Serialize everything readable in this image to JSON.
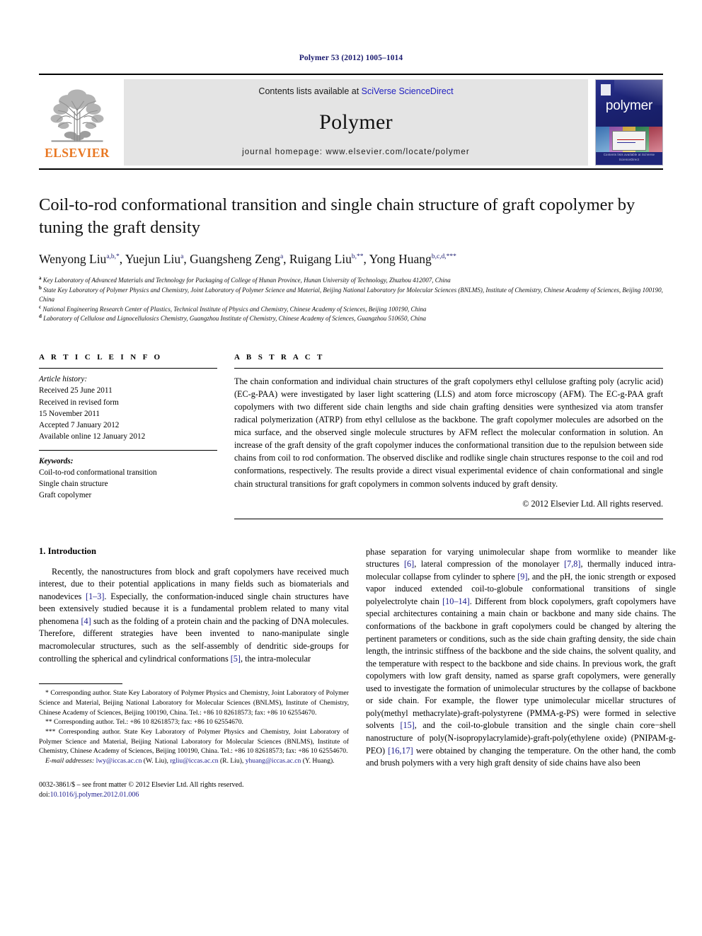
{
  "running_head": "Polymer 53 (2012) 1005–1014",
  "header": {
    "publisher": "ELSEVIER",
    "contents_prefix": "Contents lists available at ",
    "contents_link": "SciVerse ScienceDirect",
    "journal_name": "Polymer",
    "homepage": "journal homepage: www.elsevier.com/locate/polymer",
    "cover_title": "polymer",
    "cover_footer": "Contents lists available at\nSciVerse ScienceDirect"
  },
  "article": {
    "title": "Coil-to-rod conformational transition and single chain structure of graft copolymer by tuning the graft density",
    "authors": [
      {
        "name": "Wenyong Liu",
        "sup": "a,b,*"
      },
      {
        "name": "Yuejun Liu",
        "sup": "a"
      },
      {
        "name": "Guangsheng Zeng",
        "sup": "a"
      },
      {
        "name": "Ruigang Liu",
        "sup": "b,**"
      },
      {
        "name": "Yong Huang",
        "sup": "b,c,d,***"
      }
    ],
    "affiliations": [
      {
        "mark": "a",
        "text": "Key Laboratory of Advanced Materials and Technology for Packaging of College of Hunan Province, Hunan University of Technology, Zhuzhou 412007, China"
      },
      {
        "mark": "b",
        "text": "State Key Laboratory of Polymer Physics and Chemistry, Joint Laboratory of Polymer Science and Material, Beijing National Laboratory for Molecular Sciences (BNLMS), Institute of Chemistry, Chinese Academy of Sciences, Beijing 100190, China"
      },
      {
        "mark": "c",
        "text": "National Engineering Research Center of Plastics, Technical Institute of Physics and Chemistry, Chinese Academy of Sciences, Beijing 100190, China"
      },
      {
        "mark": "d",
        "text": "Laboratory of Cellulose and Lignocellulosics Chemistry, Guangzhou Institute of Chemistry, Chinese Academy of Sciences, Guangzhou 510650, China"
      }
    ]
  },
  "article_info": {
    "heading": "A R T I C L E   I N F O",
    "history_label": "Article history:",
    "history": [
      "Received 25 June 2011",
      "Received in revised form",
      "15 November 2011",
      "Accepted 7 January 2012",
      "Available online 12 January 2012"
    ],
    "keywords_label": "Keywords:",
    "keywords": [
      "Coil-to-rod conformational transition",
      "Single chain structure",
      "Graft copolymer"
    ]
  },
  "abstract": {
    "heading": "A B S T R A C T",
    "text": "The chain conformation and individual chain structures of the graft copolymers ethyl cellulose grafting poly (acrylic acid) (EC-g-PAA) were investigated by laser light scattering (LLS) and atom force microscopy (AFM). The EC-g-PAA graft copolymers with two different side chain lengths and side chain grafting densities were synthesized via atom transfer radical polymerization (ATRP) from ethyl cellulose as the backbone. The graft copolymer molecules are adsorbed on the mica surface, and the observed single molecule structures by AFM reflect the molecular conformation in solution. An increase of the graft density of the graft copolymer induces the conformational transition due to the repulsion between side chains from coil to rod conformation. The observed disclike and rodlike single chain structures response to the coil and rod conformations, respectively. The results provide a direct visual experimental evidence of chain conformational and single chain structural transitions for graft copolymers in common solvents induced by graft density.",
    "copyright": "© 2012 Elsevier Ltd. All rights reserved."
  },
  "introduction": {
    "heading": "1.  Introduction",
    "left_paragraph_1": "Recently, the nanostructures from block and graft copolymers have received much interest, due to their potential applications in many fields such as biomaterials and nanodevices [1–3]. Especially, the conformation-induced single chain structures have been extensively studied because it is a fundamental problem related to many vital phenomena [4] such as the folding of a protein chain and the packing of DNA molecules. Therefore, different strategies have been invented to nano-manipulate single macromolecular structures, such as the self-assembly of dendritic side-groups for controlling the spherical and cylindrical conformations [5], the intra-molecular",
    "right_paragraph_1": "phase separation for varying unimolecular shape from wormlike to meander like structures [6], lateral compression of the monolayer [7,8], thermally induced intra-molecular collapse from cylinder to sphere [9], and the pH, the ionic strength or exposed vapor induced extended coil-to-globule conformational transitions of single polyelectrolyte chain [10–14]. Different from block copolymers, graft copolymers have special architectures containing a main chain or backbone and many side chains. The conformations of the backbone in graft copolymers could be changed by altering the pertinent parameters or conditions, such as the side chain grafting density, the side chain length, the intrinsic stiffness of the backbone and the side chains, the solvent quality, and the temperature with respect to the backbone and side chains. In previous work, the graft copolymers with low graft density, named as sparse graft copolymers, were generally used to investigate the formation of unimolecular structures by the collapse of backbone or side chain. For example, the flower type unimolecular micellar structures of poly(methyl methacrylate)-graft-polystyrene (PMMA-g-PS) were formed in selective solvents [15], and the coil-to-globule transition and the single chain core−shell nanostructure of poly(N-isopropylacrylamide)-graft-poly(ethylene oxide) (PNIPAM-g-PEO) [16,17] were obtained by changing the temperature. On the other hand, the comb and brush polymers with a very high graft density of side chains have also been"
  },
  "footnotes": {
    "note1": "* Corresponding author. State Key Laboratory of Polymer Physics and Chemistry, Joint Laboratory of Polymer Science and Material, Beijing National Laboratory for Molecular Sciences (BNLMS), Institute of Chemistry, Chinese Academy of Sciences, Beijing 100190, China. Tel.: +86 10 82618573; fax: +86 10 62554670.",
    "note2": "** Corresponding author. Tel.: +86 10 82618573; fax: +86 10 62554670.",
    "note3": "*** Corresponding author. State Key Laboratory of Polymer Physics and Chemistry, Joint Laboratory of Polymer Science and Material, Beijing National Laboratory for Molecular Sciences (BNLMS), Institute of Chemistry, Chinese Academy of Sciences, Beijing 100190, China. Tel.: +86 10 82618573; fax: +86 10 62554670.",
    "email_label": "E-mail addresses:",
    "emails": [
      {
        "address": "lwy@iccas.ac.cn",
        "owner": "(W. Liu)"
      },
      {
        "address": "rgliu@iccas.ac.cn",
        "owner": "(R. Liu)"
      },
      {
        "address": "yhuang@iccas.ac.cn",
        "owner": "(Y. Huang)"
      }
    ]
  },
  "footer": {
    "issn_line": "0032-3861/$ – see front matter © 2012 Elsevier Ltd. All rights reserved.",
    "doi_label": "doi:",
    "doi": "10.1016/j.polymer.2012.01.006"
  },
  "colors": {
    "link_blue": "#2020c0",
    "ref_blue": "#1a1a8c",
    "elsevier_orange": "#E87722",
    "running_head_navy": "#1a1a6e",
    "header_band_gray": "#e4e4e4"
  }
}
